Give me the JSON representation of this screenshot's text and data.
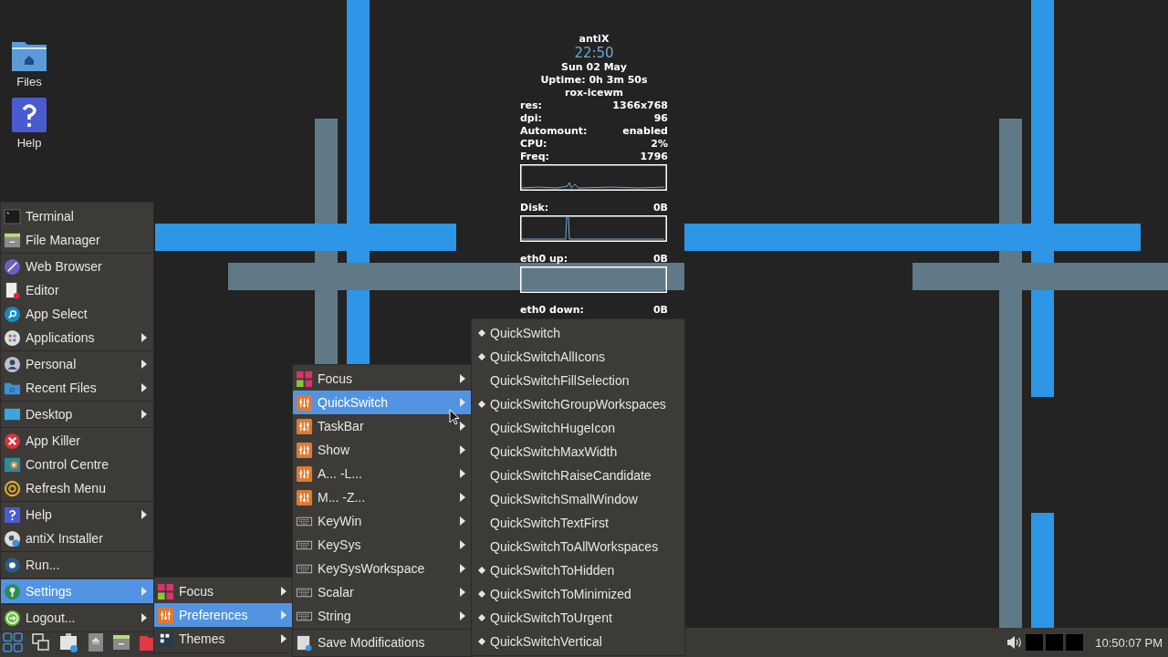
{
  "desktop_icons": [
    {
      "label": "Files"
    },
    {
      "label": "Help"
    }
  ],
  "conky": {
    "host": "antiX",
    "time": "22:50",
    "date": "Sun 02 May",
    "uptime": "Uptime: 0h 3m 50s",
    "session": "rox-icewm",
    "rows": [
      {
        "kind": "stat",
        "label": "res:",
        "value": "1366x768"
      },
      {
        "kind": "stat",
        "label": "dpi:",
        "value": "96"
      },
      {
        "kind": "stat",
        "label": "Automount:",
        "value": "enabled"
      },
      {
        "kind": "stat",
        "label": "CPU:",
        "value": "2%"
      },
      {
        "kind": "stat",
        "label": "Freq:",
        "value": "1796"
      },
      {
        "kind": "graph"
      },
      {
        "kind": "stat",
        "label": "Disk:",
        "value": "0B"
      },
      {
        "kind": "graph"
      },
      {
        "kind": "stat",
        "label": "eth0 up:",
        "value": "0B"
      },
      {
        "kind": "graph"
      },
      {
        "kind": "stat",
        "label": "eth0 down:",
        "value": "0B"
      }
    ]
  },
  "main_menu": {
    "groups": [
      [
        {
          "label": "Terminal",
          "submenu": false,
          "selected": false
        },
        {
          "label": "File Manager",
          "submenu": false,
          "selected": false
        }
      ],
      [
        {
          "label": "Web Browser",
          "submenu": false,
          "selected": false
        },
        {
          "label": "Editor",
          "submenu": false,
          "selected": false
        },
        {
          "label": "App Select",
          "submenu": false,
          "selected": false
        },
        {
          "label": "Applications",
          "submenu": true,
          "selected": false
        }
      ],
      [
        {
          "label": "Personal",
          "submenu": true,
          "selected": false
        },
        {
          "label": "Recent Files",
          "submenu": true,
          "selected": false
        }
      ],
      [
        {
          "label": "Desktop",
          "submenu": true,
          "selected": false
        }
      ],
      [
        {
          "label": "App Killer",
          "submenu": false,
          "selected": false
        },
        {
          "label": "Control Centre",
          "submenu": false,
          "selected": false
        },
        {
          "label": "Refresh Menu",
          "submenu": false,
          "selected": false
        }
      ],
      [
        {
          "label": "Help",
          "submenu": true,
          "selected": false
        },
        {
          "label": "antiX Installer",
          "submenu": false,
          "selected": false
        }
      ],
      [
        {
          "label": "Run...",
          "submenu": false,
          "selected": false
        }
      ],
      [
        {
          "label": "Settings",
          "submenu": true,
          "selected": true
        }
      ],
      [
        {
          "label": "Logout...",
          "submenu": true,
          "selected": false
        }
      ]
    ]
  },
  "settings_menu": {
    "items": [
      {
        "label": "Focus",
        "submenu": true,
        "selected": false
      },
      {
        "label": "Preferences",
        "submenu": true,
        "selected": true
      },
      {
        "label": "Themes",
        "submenu": true,
        "selected": false
      }
    ]
  },
  "preferences_menu": {
    "groups": [
      [
        {
          "label": "Focus",
          "submenu": true,
          "selected": false
        },
        {
          "label": "QuickSwitch",
          "submenu": true,
          "selected": true
        },
        {
          "label": "TaskBar",
          "submenu": true,
          "selected": false
        },
        {
          "label": "Show",
          "submenu": true,
          "selected": false
        },
        {
          "label": "A... -L...",
          "submenu": true,
          "selected": false
        },
        {
          "label": "M... -Z...",
          "submenu": true,
          "selected": false
        },
        {
          "label": "KeyWin",
          "submenu": true,
          "selected": false
        },
        {
          "label": "KeySys",
          "submenu": true,
          "selected": false
        },
        {
          "label": "KeySysWorkspace",
          "submenu": true,
          "selected": false
        },
        {
          "label": "Scalar",
          "submenu": true,
          "selected": false
        },
        {
          "label": "String",
          "submenu": true,
          "selected": false
        }
      ],
      [
        {
          "label": "Save Modifications",
          "submenu": false,
          "selected": false
        }
      ]
    ]
  },
  "quickswitch_menu": {
    "items": [
      {
        "label": "QuickSwitch",
        "checked": true
      },
      {
        "label": "QuickSwitchAllIcons",
        "checked": true
      },
      {
        "label": "QuickSwitchFillSelection",
        "checked": false
      },
      {
        "label": "QuickSwitchGroupWorkspaces",
        "checked": true
      },
      {
        "label": "QuickSwitchHugeIcon",
        "checked": false
      },
      {
        "label": "QuickSwitchMaxWidth",
        "checked": false
      },
      {
        "label": "QuickSwitchRaiseCandidate",
        "checked": false
      },
      {
        "label": "QuickSwitchSmallWindow",
        "checked": false
      },
      {
        "label": "QuickSwitchTextFirst",
        "checked": false
      },
      {
        "label": "QuickSwitchToAllWorkspaces",
        "checked": false
      },
      {
        "label": "QuickSwitchToHidden",
        "checked": true
      },
      {
        "label": "QuickSwitchToMinimized",
        "checked": true
      },
      {
        "label": "QuickSwitchToUrgent",
        "checked": true
      },
      {
        "label": "QuickSwitchVertical",
        "checked": true
      }
    ]
  },
  "taskbar": {
    "clock": "10:50:07 PM"
  }
}
